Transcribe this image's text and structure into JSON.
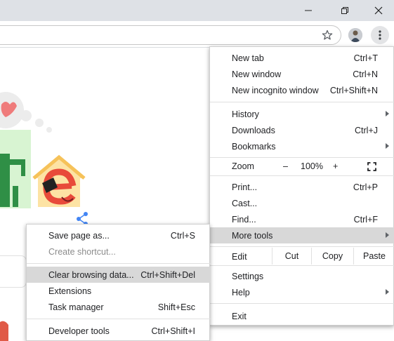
{
  "menu": {
    "new_tab": {
      "label": "New tab",
      "shortcut": "Ctrl+T"
    },
    "new_window": {
      "label": "New window",
      "shortcut": "Ctrl+N"
    },
    "new_incognito": {
      "label": "New incognito window",
      "shortcut": "Ctrl+Shift+N"
    },
    "history": {
      "label": "History"
    },
    "downloads": {
      "label": "Downloads",
      "shortcut": "Ctrl+J"
    },
    "bookmarks": {
      "label": "Bookmarks"
    },
    "zoom": {
      "label": "Zoom",
      "minus": "–",
      "value": "100%",
      "plus": "+"
    },
    "print": {
      "label": "Print...",
      "shortcut": "Ctrl+P"
    },
    "cast": {
      "label": "Cast..."
    },
    "find": {
      "label": "Find...",
      "shortcut": "Ctrl+F"
    },
    "more_tools": {
      "label": "More tools"
    },
    "edit": {
      "label": "Edit",
      "cut": "Cut",
      "copy": "Copy",
      "paste": "Paste"
    },
    "settings": {
      "label": "Settings"
    },
    "help": {
      "label": "Help"
    },
    "exit": {
      "label": "Exit"
    }
  },
  "submenu": {
    "save_page": {
      "label": "Save page as...",
      "shortcut": "Ctrl+S"
    },
    "create_shortcut": {
      "label": "Create shortcut..."
    },
    "clear_browsing": {
      "label": "Clear browsing data...",
      "shortcut": "Ctrl+Shift+Del"
    },
    "extensions": {
      "label": "Extensions"
    },
    "task_manager": {
      "label": "Task manager",
      "shortcut": "Shift+Esc"
    },
    "developer_tools": {
      "label": "Developer tools",
      "shortcut": "Ctrl+Shift+I"
    }
  },
  "colors": {
    "highlight": "#d8d8d8",
    "titlebar": "#dee1e6",
    "share_blue": "#4285f4"
  }
}
